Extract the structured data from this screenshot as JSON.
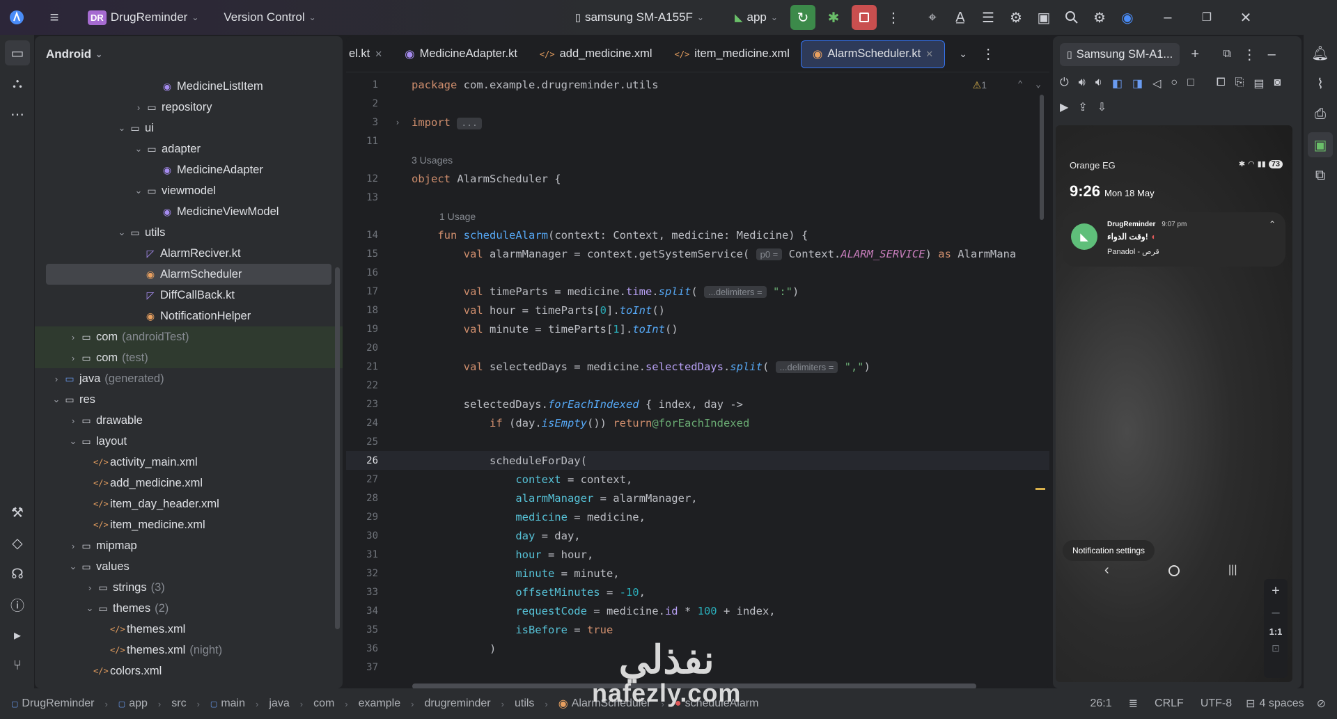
{
  "titlebar": {
    "project_badge": "DR",
    "project_name": "DrugReminder",
    "vcs": "Version Control",
    "device": "samsung SM-A155F",
    "run_config": "app"
  },
  "project_panel": {
    "view_mode": "Android",
    "items": [
      {
        "label": "MedicineListItem",
        "extra": ""
      },
      {
        "label": "repository",
        "extra": ""
      },
      {
        "label": "ui",
        "extra": ""
      },
      {
        "label": "adapter",
        "extra": ""
      },
      {
        "label": "MedicineAdapter",
        "extra": ""
      },
      {
        "label": "viewmodel",
        "extra": ""
      },
      {
        "label": "MedicineViewModel",
        "extra": ""
      },
      {
        "label": "utils",
        "extra": ""
      },
      {
        "label": "AlarmReciver.kt",
        "extra": ""
      },
      {
        "label": "AlarmScheduler",
        "extra": ""
      },
      {
        "label": "DiffCallBack.kt",
        "extra": ""
      },
      {
        "label": "NotificationHelper",
        "extra": ""
      },
      {
        "label": "com",
        "extra": "(androidTest)"
      },
      {
        "label": "com",
        "extra": "(test)"
      },
      {
        "label": "java",
        "extra": "(generated)"
      },
      {
        "label": "res",
        "extra": ""
      },
      {
        "label": "drawable",
        "extra": ""
      },
      {
        "label": "layout",
        "extra": ""
      },
      {
        "label": "activity_main.xml",
        "extra": ""
      },
      {
        "label": "add_medicine.xml",
        "extra": ""
      },
      {
        "label": "item_day_header.xml",
        "extra": ""
      },
      {
        "label": "item_medicine.xml",
        "extra": ""
      },
      {
        "label": "mipmap",
        "extra": ""
      },
      {
        "label": "values",
        "extra": ""
      },
      {
        "label": "strings",
        "extra": "(3)"
      },
      {
        "label": "themes",
        "extra": "(2)"
      },
      {
        "label": "themes.xml",
        "extra": ""
      },
      {
        "label": "themes.xml",
        "extra": "(night)"
      },
      {
        "label": "colors.xml",
        "extra": ""
      }
    ]
  },
  "editor": {
    "tabs": [
      {
        "label": "el.kt"
      },
      {
        "label": "MedicineAdapter.kt"
      },
      {
        "label": "add_medicine.xml"
      },
      {
        "label": "item_medicine.xml"
      },
      {
        "label": "AlarmScheduler.kt"
      }
    ],
    "warning_count": "1",
    "usages_3": "3 Usages",
    "usages_1": "1 Usage",
    "hint_p0": "p0 =",
    "hint_delims": "...delimiters =",
    "line_numbers": [
      "1",
      "2",
      "3",
      "11",
      "",
      "12",
      "13",
      "",
      "14",
      "15",
      "16",
      "17",
      "18",
      "19",
      "20",
      "21",
      "22",
      "23",
      "24",
      "25",
      "26",
      "27",
      "28",
      "29",
      "30",
      "31",
      "32",
      "33",
      "34",
      "35",
      "36",
      "37"
    ]
  },
  "emulator": {
    "device_tab": "Samsung SM-A1...",
    "carrier": "Orange EG",
    "time": "9:26",
    "date": "Mon 18 May",
    "battery": "73",
    "notif_app": "DrugReminder",
    "notif_time": "9:07 pm",
    "notif_title": "وقت الدواء!",
    "notif_body": "Panadol - قرص",
    "notif_settings": "Notification settings",
    "zoom_ratio": "1:1"
  },
  "statusbar": {
    "crumbs": [
      "DrugReminder",
      "app",
      "src",
      "main",
      "java",
      "com",
      "example",
      "drugreminder",
      "utils",
      "AlarmScheduler",
      "scheduleAlarm"
    ],
    "position": "26:1",
    "line_sep": "CRLF",
    "encoding": "UTF-8",
    "indent": "4 spaces"
  },
  "watermark": {
    "arabic": "نفذلي",
    "latin": "nafezly.com"
  }
}
